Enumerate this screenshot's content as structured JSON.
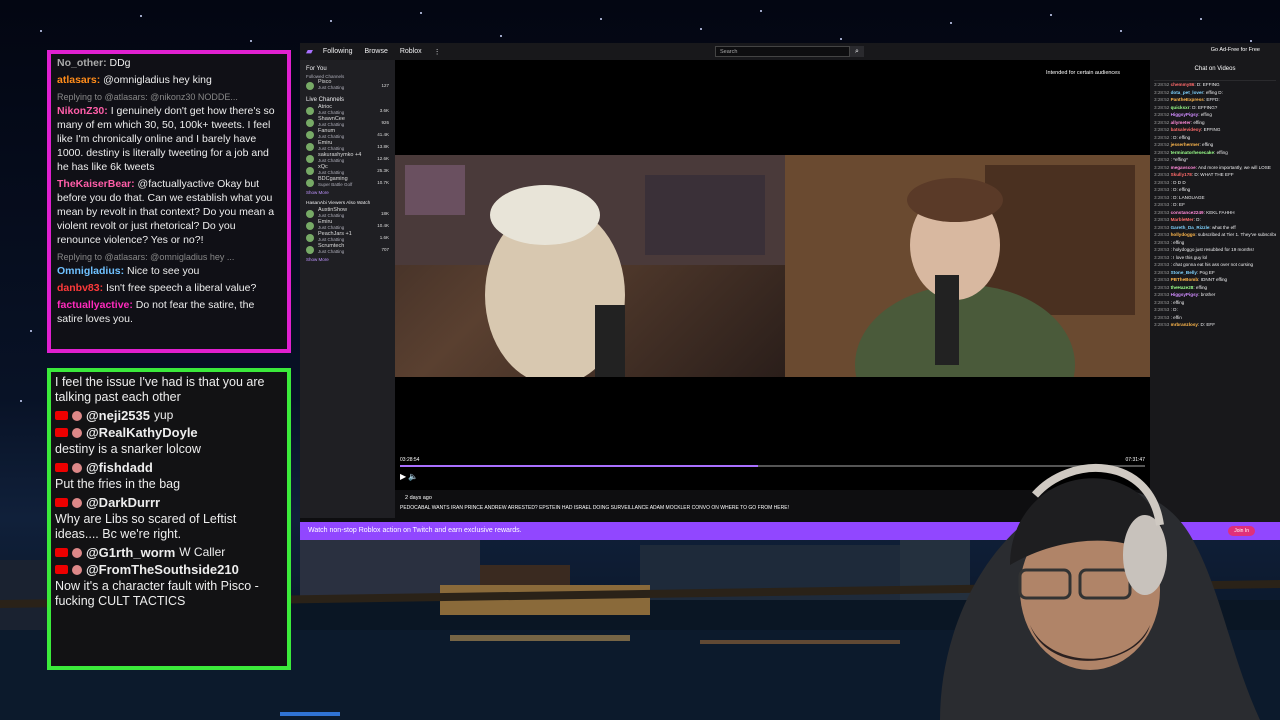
{
  "twitch_chat_overlay": {
    "messages": [
      {
        "reply": "",
        "user": "No_other:",
        "text": "DDg",
        "color": "#aaaaaa"
      },
      {
        "reply": "",
        "user": "atlasars:",
        "text": "@omnigladius hey king",
        "color": "#ff8c1a"
      },
      {
        "reply": "Replying to @atlasars: @nikonz30 NODDE...",
        "user": "NikonZ30:",
        "text": "I genuinely don't get how there's so many of em which 30, 50, 100k+ tweets. I feel like I'm chronically online and I barely have 1000. destiny is literally tweeting for a job and he has like 6k tweets",
        "color": "#ff5ea8"
      },
      {
        "reply": "",
        "user": "TheKaiserBear:",
        "text": "@factuallyactive Okay but before you do that. Can we establish what you mean by revolt in that context? Do you mean a violent revolt or just rhetorical? Do you renounce violence? Yes or no?!",
        "color": "#ff5ea8"
      },
      {
        "reply": "Replying to @atlasars: @omnigladius hey ...",
        "user": "Omnigladius:",
        "text": "Nice to see you",
        "color": "#6fc1ff"
      },
      {
        "reply": "",
        "user": "danbv83:",
        "text": "Isn't free speech a liberal value?",
        "color": "#ff3a3a"
      },
      {
        "reply": "",
        "user": "factuallyactive:",
        "text": "Do not fear the satire, the satire loves you.",
        "color": "#ff2bbd"
      }
    ]
  },
  "youtube_chat_overlay": {
    "first_text": "I feel the issue I've had is that you are talking past each other",
    "messages": [
      {
        "user": "@neji2535",
        "text": "yup",
        "inline": true
      },
      {
        "user": "@RealKathyDoyle",
        "text": "destiny is a snarker lolcow",
        "inline": false
      },
      {
        "user": "@fishdadd",
        "text": "Put the fries in the bag",
        "inline": false
      },
      {
        "user": "@DarkDurrr",
        "text": "Why are Libs so scared of Leftist ideas.... Bc we're right.",
        "inline": false
      },
      {
        "user": "@G1rth_worm",
        "text": "W Caller",
        "inline": true
      },
      {
        "user": "@FromTheSouthside210",
        "text": "Now it's a character fault with Pisco - fucking CULT TACTICS",
        "inline": false
      }
    ]
  },
  "twitch": {
    "nav": {
      "following": "Following",
      "browse": "Browse",
      "roblox": "Roblox",
      "more": "⋮"
    },
    "search_placeholder": "Search",
    "ad_free": "Go Ad-Free for Free",
    "sidebar": {
      "for_you": "For You",
      "followed_label": "Followed Channels",
      "followed": [
        {
          "name": "Pisco",
          "sub": "Just Chatting",
          "count": "127"
        }
      ],
      "live_label": "Live Channels",
      "live": [
        {
          "name": "Atrioc",
          "sub": "Just Chatting",
          "count": "3.6K"
        },
        {
          "name": "ShawnCee",
          "sub": "Just Chatting",
          "count": "926"
        },
        {
          "name": "Fanum",
          "sub": "Just Chatting",
          "count": "41.4K"
        },
        {
          "name": "Emiru",
          "sub": "Just Chatting",
          "count": "13.8K"
        },
        {
          "name": "sakurashymko +4",
          "sub": "Just Chatting",
          "count": "12.6K"
        },
        {
          "name": "xQc",
          "sub": "Just Chatting",
          "count": "25.3K"
        },
        {
          "name": "BDCgaming",
          "sub": "Super Battle Golf",
          "count": "10.7K"
        }
      ],
      "show_more": "Show More",
      "also_label": "HasanAbi Viewers Also Watch",
      "also": [
        {
          "name": "AustinShow",
          "sub": "Just Chatting",
          "count": "18K"
        },
        {
          "name": "Emiru",
          "sub": "Just Chatting",
          "count": "10.4K"
        },
        {
          "name": "PeachJars +1",
          "sub": "Just Chatting",
          "count": "1.6K"
        },
        {
          "name": "Scrumtech",
          "sub": "Just Chatting",
          "count": "707"
        }
      ],
      "show_more2": "Show More"
    },
    "audience": "Intended for certain audiences",
    "time_current": "03:28:54",
    "time_total": "07:31:47",
    "progress": 0.48,
    "ago": "2 days ago",
    "video_title": "PEDOCABAL WANTS IRAN PRINCE ANDREW ARRESTED? EPSTEIN HAD ISRAEL DOING SURVEILLANCE ADAM MOCKLER CONVO ON WHERE TO GO FROM HERE!",
    "banner": "Watch non-stop Roblox action on Twitch and earn exclusive rewards.",
    "join": "Join In",
    "chat_header": "Chat on Videos",
    "chat": [
      {
        "t": "3:28:52",
        "u": "chemmy86",
        "m": "D: EFFING"
      },
      {
        "t": "3:28:52",
        "u": "dota_pet_lover",
        "m": "effing D:"
      },
      {
        "t": "3:28:52",
        "u": "PantheExpress",
        "m": "EFFD:"
      },
      {
        "t": "3:28:52",
        "u": "quicksxr",
        "m": "D: EFFING?"
      },
      {
        "t": "3:28:52",
        "u": "HiggsyPigsy",
        "m": "effing"
      },
      {
        "t": "3:28:52",
        "u": "allymeter",
        "m": "effing"
      },
      {
        "t": "3:28:52",
        "u": "batsalevideoy",
        "m": "EFFING"
      },
      {
        "t": "3:28:52",
        "u": "",
        "m": "D: effing"
      },
      {
        "t": "3:28:52",
        "u": "jesserhermer",
        "m": "effing"
      },
      {
        "t": "3:28:52",
        "u": "terminatorhesecake",
        "m": "effing"
      },
      {
        "t": "3:28:52",
        "u": "",
        "m": "*effing*"
      },
      {
        "t": "3:28:52",
        "u": "megavscoe",
        "m": "And more importantly, we will LOSE"
      },
      {
        "t": "3:28:53",
        "u": "Skully178",
        "m": "D: WHAT THE EFF"
      },
      {
        "t": "3:28:53",
        "u": "",
        "m": "D D D"
      },
      {
        "t": "3:28:53",
        "u": "",
        "m": "D: effing"
      },
      {
        "t": "3:28:53",
        "u": "",
        "m": "D: LANGUAGE"
      },
      {
        "t": "3:28:53",
        "u": "",
        "m": "D: EF"
      },
      {
        "t": "3:28:53",
        "u": "constance2249",
        "m": "KEKL FAHHH"
      },
      {
        "t": "3:28:53",
        "u": "MarbleMer",
        "m": "D:"
      },
      {
        "t": "3:28:53",
        "u": "Gareth_Da_Rizzle",
        "m": "what the eff"
      },
      {
        "t": "3:28:53",
        "u": "hollydoggo",
        "m": "subscribed at Tier 1. They've subscribed for 19 months"
      },
      {
        "t": "3:28:53",
        "u": "",
        "m": "effing"
      },
      {
        "t": "3:28:53",
        "u": "",
        "m": "holydoggo just resubbed for 19 months!"
      },
      {
        "t": "3:28:53",
        "u": "",
        "m": "I love this guy lol"
      },
      {
        "t": "3:28:53",
        "u": "",
        "m": "chat gonna eat his ass over not cursing"
      },
      {
        "t": "3:28:53",
        "u": "Stone_Belly",
        "m": "Pog EF"
      },
      {
        "t": "3:28:53",
        "u": "PBTheBomb",
        "m": "IDNNT effing"
      },
      {
        "t": "3:28:53",
        "u": "theHaze28",
        "m": "effing"
      },
      {
        "t": "3:28:53",
        "u": "HiggsyPigsy",
        "m": "brother"
      },
      {
        "t": "3:28:53",
        "u": "",
        "m": "effing"
      },
      {
        "t": "3:28:53",
        "u": "",
        "m": "D:"
      },
      {
        "t": "3:28:53",
        "u": "",
        "m": "effin"
      },
      {
        "t": "3:28:53",
        "u": "mrbranzlosy",
        "m": "D: EFF"
      }
    ]
  }
}
